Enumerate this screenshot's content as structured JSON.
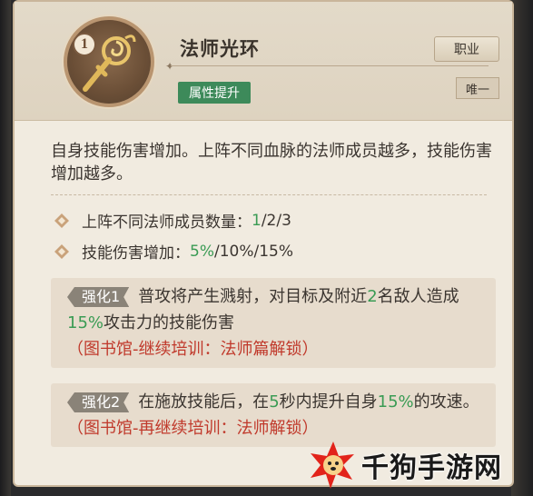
{
  "skill": {
    "rank": "1",
    "title": "法师光环",
    "category_tag": "属性提升",
    "class_button": "职业",
    "unique_tag": "唯一",
    "description": "自身技能伤害增加。上阵不同血脉的法师成员越多，技能伤害增加越多。"
  },
  "stats": [
    {
      "label": "上阵不同法师成员数量：",
      "value_first": "1",
      "value_rest": "/2/3"
    },
    {
      "label": "技能伤害增加：",
      "value_first": "5%",
      "value_rest": "/10%/15%"
    }
  ],
  "enhancements": [
    {
      "badge": "强化1",
      "parts": [
        {
          "text": "普攻将产生溅射，对目标及附近",
          "style": "normal"
        },
        {
          "text": "2",
          "style": "green"
        },
        {
          "text": "名敌人造成",
          "style": "normal"
        },
        {
          "text": "15%",
          "style": "green"
        },
        {
          "text": "攻击力的技能伤害",
          "style": "normal"
        },
        {
          "text": "（图书馆-继续培训：法师篇解锁）",
          "style": "red"
        }
      ]
    },
    {
      "badge": "强化2",
      "parts": [
        {
          "text": "在施放技能后，在",
          "style": "normal"
        },
        {
          "text": "5",
          "style": "green"
        },
        {
          "text": "秒内提升自身",
          "style": "normal"
        },
        {
          "text": "15%",
          "style": "green"
        },
        {
          "text": "的攻速。",
          "style": "normal"
        },
        {
          "text": "（图书馆-再继续培训：法师解锁）",
          "style": "red"
        }
      ]
    }
  ],
  "watermark": {
    "text": "千狗手游网"
  },
  "colors": {
    "green": "#3a9b54",
    "red": "#c0392b",
    "tag_green": "#3d8a5a"
  },
  "icons": {
    "emblem": "golden-scepter-icon",
    "stat_bullet": "diamond-bullet-icon"
  }
}
